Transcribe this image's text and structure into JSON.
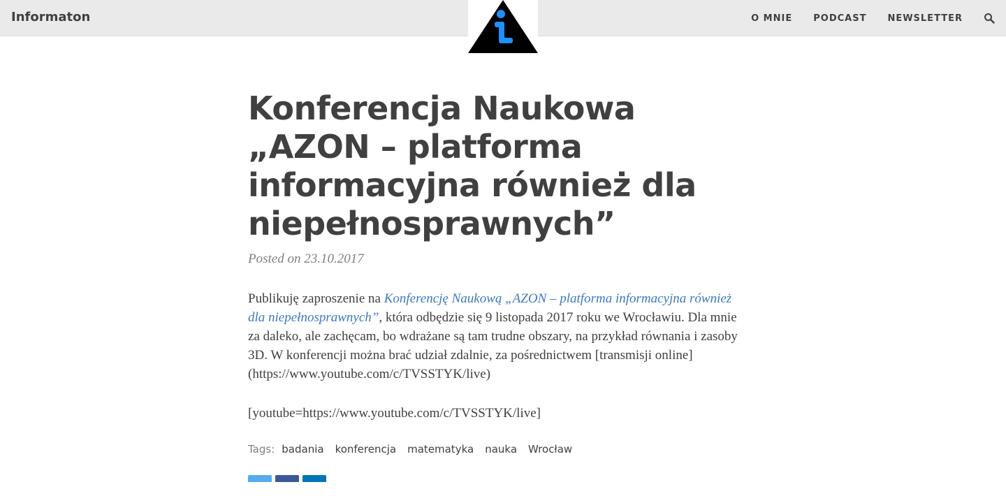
{
  "site": {
    "brand": "Informaton"
  },
  "nav": {
    "items": [
      {
        "label": "O MNIE"
      },
      {
        "label": "PODCAST"
      },
      {
        "label": "NEWSLETTER"
      }
    ],
    "search_icon": "search-icon"
  },
  "post": {
    "title": "Konferencja Naukowa „AZON – platforma informacyjna również dla niepełnosprawnych”",
    "meta": "Posted on 23.10.2017",
    "intro": "Publikuję zaproszenie na ",
    "link_text": "Konferencję Naukową „AZON – platforma informacyjna również dla niepełnosprawnych”",
    "body_rest": ", która odbędzie się 9 listopada 2017 roku we Wrocławiu. Dla mnie za daleko, ale zachęcam, bo wdrażane są tam trudne obszary, na przykład równania i zasoby 3D. W konferencji można brać udział zdalnie, za pośrednictwem [transmisji online](https://www.youtube.com/c/TVSSTYK/live)",
    "embed": "[youtube=https://www.youtube.com/c/TVSSTYK/live]"
  },
  "tags": {
    "label": "Tags:",
    "items": [
      "badania",
      "konferencja",
      "matematyka",
      "nauka",
      "Wrocław"
    ]
  },
  "share": {
    "buttons": [
      {
        "name": "twitter",
        "color": "#55acee"
      },
      {
        "name": "facebook",
        "color": "#3b5998"
      },
      {
        "name": "linkedin",
        "color": "#0077b5"
      }
    ]
  },
  "colors": {
    "link": "#3c78c4",
    "text": "#404040",
    "navbar": "#eaeaea",
    "logo_accent": "#1e90ff"
  }
}
